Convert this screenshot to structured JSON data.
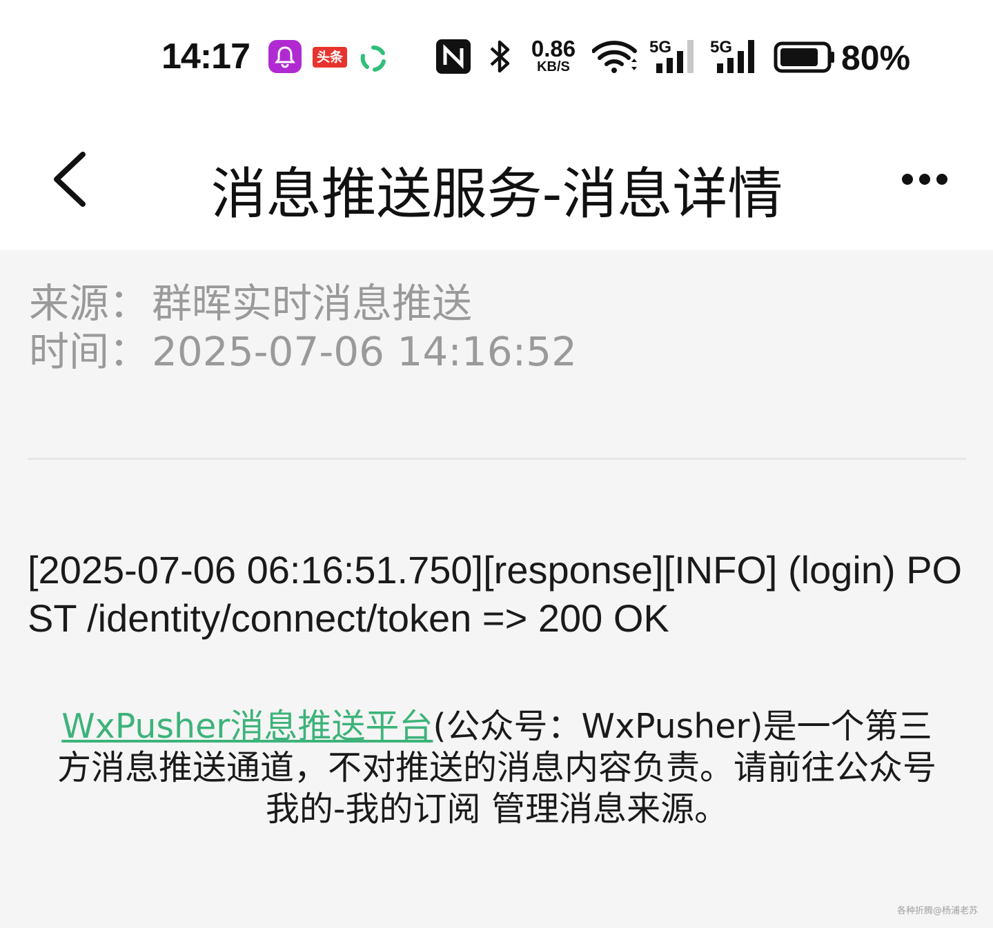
{
  "status_bar": {
    "time": "14:17",
    "toutiao_label": "头条",
    "net_speed": "0.86",
    "net_speed_unit": "KB/S",
    "signal1_label": "5G",
    "signal2_label": "5G",
    "battery": "80%",
    "icons": [
      "bell-app-icon",
      "toutiao-app-icon",
      "green-app-icon",
      "nfc-icon",
      "bluetooth-icon",
      "wifi-icon",
      "signal-icon",
      "signal-icon",
      "battery-icon"
    ]
  },
  "header": {
    "title": "消息推送服务-消息详情",
    "back_icon": "chevron-left-icon",
    "more_icon": "more-dots-icon"
  },
  "meta": {
    "source_label": "来源：",
    "source_value": "群晖实时消息推送",
    "time_label": "时间：",
    "time_value": "2025-07-06 14:16:52"
  },
  "message": {
    "body": "[2025-07-06 06:16:51.750][response][INFO] (login) POST /identity/connect/token => 200 OK"
  },
  "footer": {
    "link_text": "WxPusher消息推送平台",
    "text": "(公众号：WxPusher)是一个第三方消息推送通道，不对推送的消息内容负责。请前往公众号 我的-我的订阅 管理消息来源。"
  },
  "watermark": "各种折腾@杨浦老苏",
  "colors": {
    "link": "#3db37a",
    "meta_text": "#9a9a9a",
    "background": "#f5f5f5"
  }
}
